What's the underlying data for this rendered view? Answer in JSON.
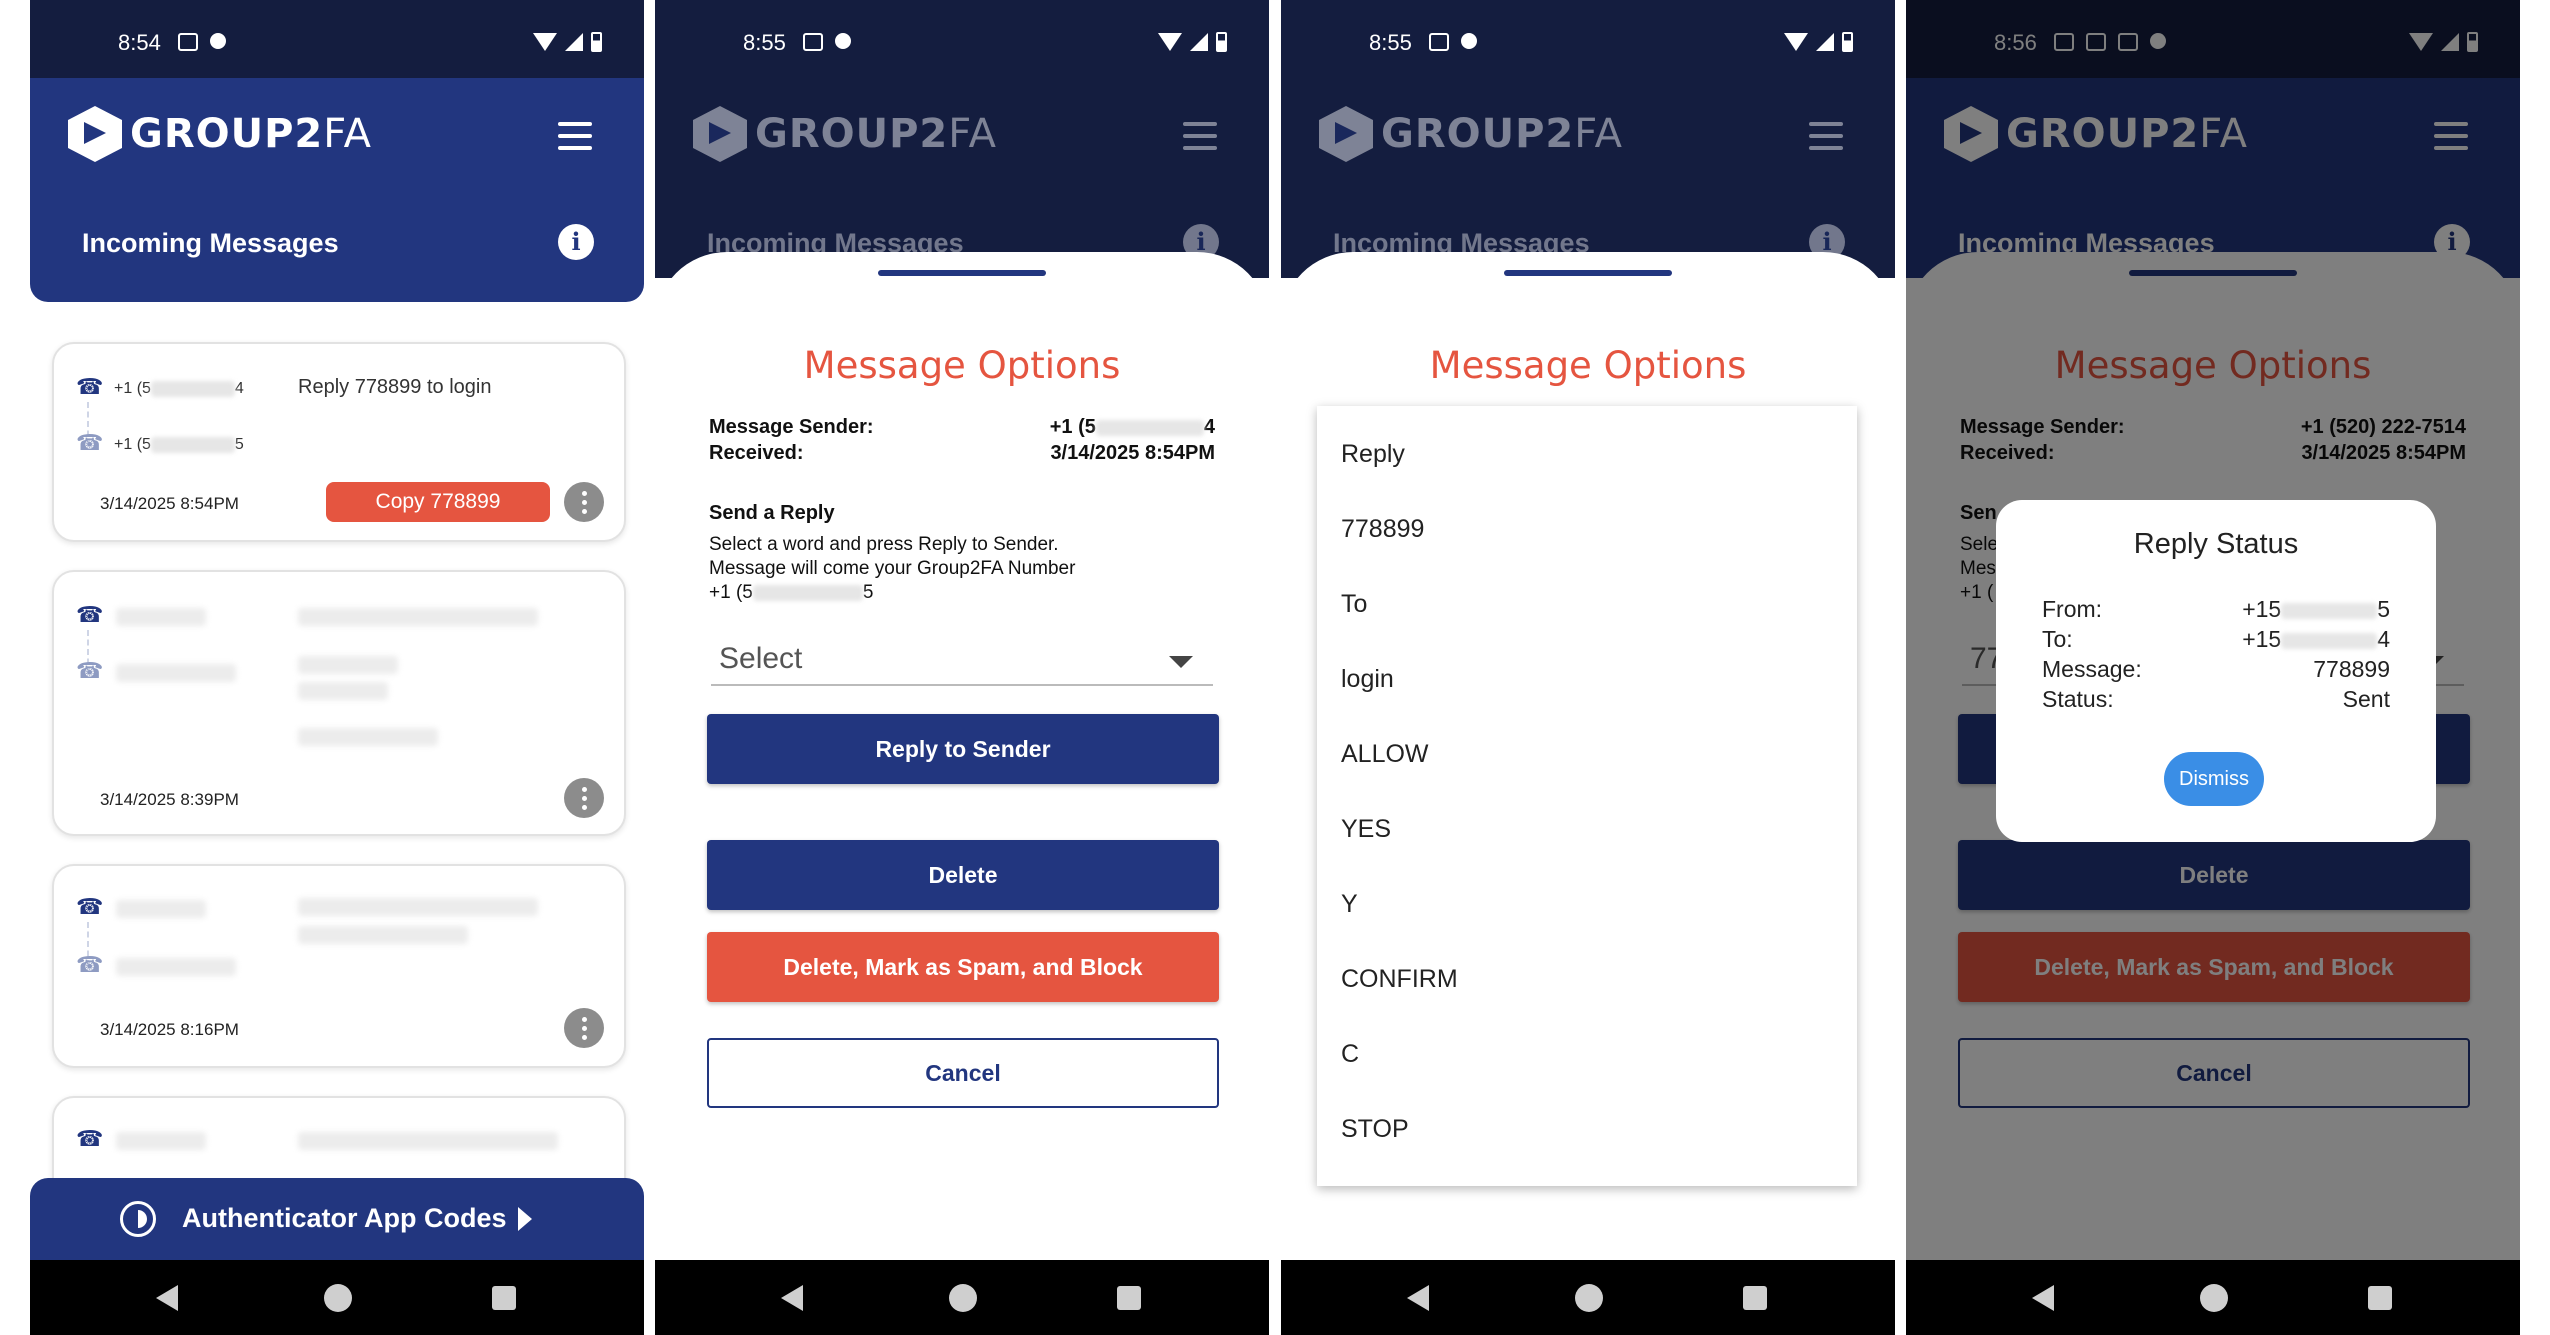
{
  "status": {
    "p1_time": "8:54",
    "p2_time": "8:55",
    "p3_time": "8:55",
    "p4_time": "8:56"
  },
  "app": {
    "brand_bold": "GROUP2",
    "brand_thin": "FA",
    "section_title": "Incoming Messages"
  },
  "messages": [
    {
      "from_prefix": "+1 (5",
      "from_suffix": "4",
      "to_prefix": "+1 (5",
      "to_suffix": "5",
      "text": "Reply 778899 to login",
      "datetime": "3/14/2025 8:54PM",
      "copy_label": "Copy  778899"
    },
    {
      "datetime": "3/14/2025 8:39PM"
    },
    {
      "datetime": "3/14/2025 8:16PM"
    }
  ],
  "footer": {
    "auth_label": "Authenticator App Codes"
  },
  "options": {
    "title": "Message Options",
    "sender_label": "Message Sender:",
    "sender_prefix": "+1 (5",
    "sender_suffix": "4",
    "received_label": "Received:",
    "received_value": "3/14/2025 8:54PM",
    "send_reply_title": "Send a Reply",
    "instructions_1": "Select a word and press Reply to Sender.",
    "instructions_2": "Message will come your Group2FA Number",
    "own_number_prefix": "+1 (5",
    "own_number_suffix": "5",
    "select_placeholder": "Select",
    "reply_button": "Reply to Sender",
    "delete_button": "Delete",
    "spam_button": "Delete, Mark as Spam, and Block",
    "cancel_button": "Cancel"
  },
  "dropdown_items": [
    "Reply",
    "778899",
    "To",
    "login",
    "ALLOW",
    "YES",
    "Y",
    "CONFIRM",
    "C",
    "STOP"
  ],
  "panel4": {
    "sender_value": "+1 (520) 222-7514",
    "received_value": "3/14/2025 8:54PM",
    "sen_partial": "Sen",
    "sel_partial": "Sele",
    "mes_partial": "Mes",
    "plus_partial": "+1 (",
    "select_partial": "77",
    "reply_status": {
      "title": "Reply Status",
      "from_label": "From:",
      "from_prefix": "+15",
      "from_suffix": "5",
      "to_label": "To:",
      "to_prefix": "+15",
      "to_suffix": "4",
      "message_label": "Message:",
      "message_value": "778899",
      "status_label": "Status:",
      "status_value": "Sent",
      "dismiss_label": "Dismiss"
    }
  }
}
